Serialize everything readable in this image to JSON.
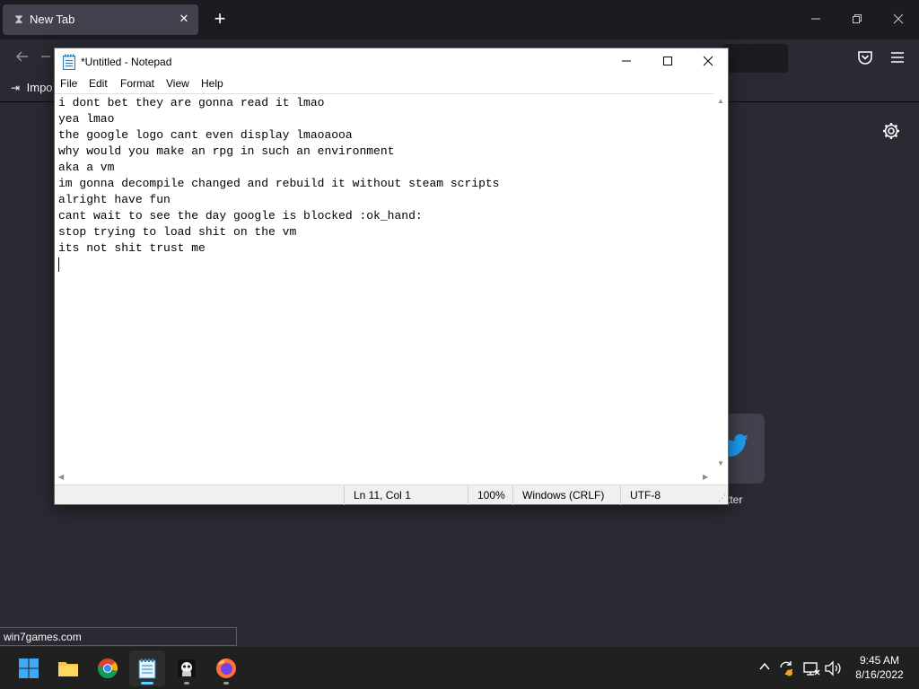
{
  "browser": {
    "tab": {
      "title": "New Tab"
    },
    "new_tab_symbol": "+",
    "bookmarks": {
      "import_label": "Impo"
    },
    "shortcut_tile": {
      "label_fragment": "tter",
      "icon": "twitter-bird-icon"
    },
    "status_url": "win7games.com",
    "colors": {
      "background": "#2b2a33",
      "toolbar": "#1c1b22",
      "tab": "#42414d"
    }
  },
  "notepad": {
    "title": "*Untitled - Notepad",
    "menu": [
      "File",
      "Edit",
      "Format",
      "View",
      "Help"
    ],
    "lines": [
      "i dont bet they are gonna read it lmao",
      "yea lmao",
      "the google logo cant even display lmaoaooa",
      "why would you make an rpg in such an environment",
      "aka a vm",
      "im gonna decompile changed and rebuild it without steam scripts",
      "alright have fun",
      "cant wait to see the day google is blocked :ok_hand:",
      "stop trying to load shit on the vm",
      "its not shit trust me",
      ""
    ],
    "status": {
      "position": "Ln 11, Col 1",
      "zoom": "100%",
      "line_ending": "Windows (CRLF)",
      "encoding": "UTF-8"
    }
  },
  "taskbar": {
    "apps": [
      "start-icon",
      "file-explorer-icon",
      "chrome-icon",
      "notepad-icon",
      "game-icon",
      "firefox-icon"
    ],
    "clock": {
      "time": "9:45 AM",
      "date": "8/16/2022"
    },
    "accent": "#60cdff"
  }
}
